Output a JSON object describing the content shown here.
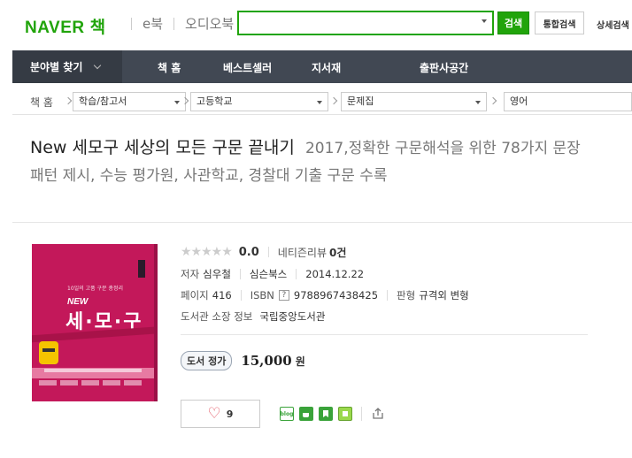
{
  "header": {
    "logo_text": "NAVER",
    "logo_book": "책",
    "nav": [
      "e북",
      "오디오북"
    ],
    "search_placeholder": "",
    "search_button": "검색",
    "total_search_button": "통합검색",
    "detail_search": "상세검색"
  },
  "catbar": {
    "first_label": "분야별 찾기",
    "items": [
      "책 홈",
      "베스트셀러",
      "지서재",
      "출판사공간"
    ]
  },
  "crumbs": {
    "home": "책 홈",
    "selects": [
      "학습/참고서",
      "고등학교",
      "문제집",
      "영어"
    ]
  },
  "title": {
    "main": "New 세모구 세상의 모든 구문 끝내기",
    "sub": "2017,정확한 구문해석을 위한 78가지 문장 패턴 제시, 수능 평가원, 사관학교, 경찰대 기출 구문 수록"
  },
  "cover": {
    "top_text": "10일의 고품 구문 총정리",
    "new_text": "NEW",
    "title_text": "세·모·구"
  },
  "info": {
    "score": "0.0",
    "review_label": "네티즌리뷰",
    "review_count": "0건",
    "author_label": "저자",
    "author": "심우철",
    "publisher": "심슨북스",
    "date": "2014.12.22",
    "pages_label": "페이지",
    "pages": "416",
    "isbn_label": "ISBN",
    "isbn_q": "?",
    "isbn": "9788967438425",
    "format_label": "판형",
    "format": "규격외 변형",
    "library_label": "도서관 소장 정보",
    "library": "국립중앙도서관",
    "price_label": "도서 정가",
    "price": "15,000",
    "price_unit": "원",
    "like_count": "9"
  },
  "share": {
    "blog": "blog"
  }
}
